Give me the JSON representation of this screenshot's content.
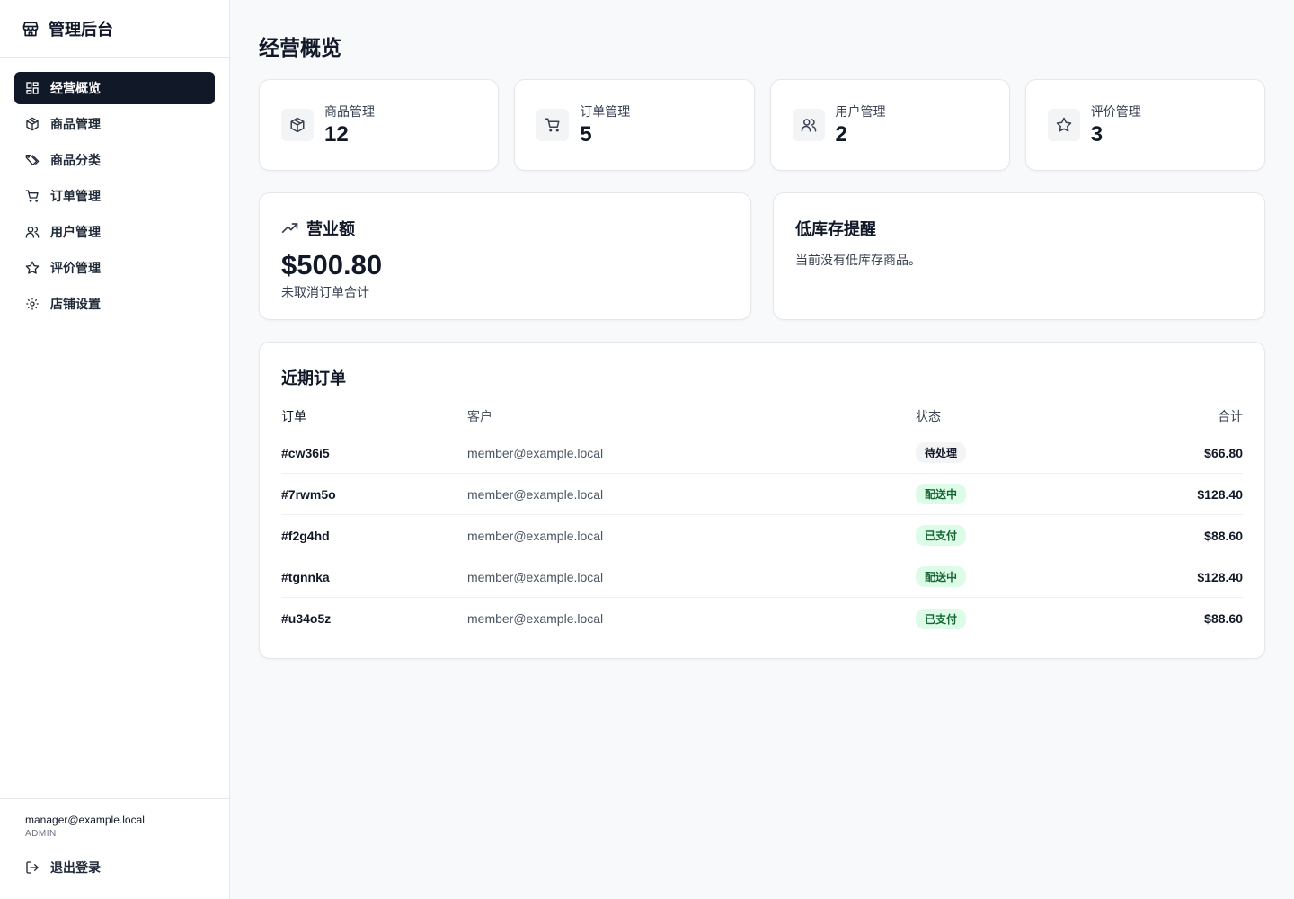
{
  "app": {
    "title": "管理后台"
  },
  "sidebar": {
    "items": [
      {
        "label": "经营概览",
        "icon": "dashboard-icon",
        "active": true
      },
      {
        "label": "商品管理",
        "icon": "package-icon"
      },
      {
        "label": "商品分类",
        "icon": "tags-icon"
      },
      {
        "label": "订单管理",
        "icon": "cart-icon"
      },
      {
        "label": "用户管理",
        "icon": "users-icon"
      },
      {
        "label": "评价管理",
        "icon": "star-icon"
      },
      {
        "label": "店铺设置",
        "icon": "gear-icon"
      }
    ],
    "user": {
      "email": "manager@example.local",
      "role": "ADMIN"
    },
    "logout_label": "退出登录"
  },
  "page": {
    "title": "经营概览"
  },
  "stats": [
    {
      "label": "商品管理",
      "value": "12",
      "icon": "package-icon"
    },
    {
      "label": "订单管理",
      "value": "5",
      "icon": "cart-icon"
    },
    {
      "label": "用户管理",
      "value": "2",
      "icon": "users-icon"
    },
    {
      "label": "评价管理",
      "value": "3",
      "icon": "star-icon"
    }
  ],
  "revenue": {
    "title": "营业额",
    "value": "$500.80",
    "note": "未取消订单合计",
    "icon": "trending-up-icon"
  },
  "low_stock": {
    "title": "低库存提醒",
    "text": "当前没有低库存商品。"
  },
  "recent_orders": {
    "title": "近期订单",
    "columns": [
      "订单",
      "客户",
      "状态",
      "合计"
    ],
    "rows": [
      {
        "id": "#cw36i5",
        "customer": "member@example.local",
        "status": "待处理",
        "total": "$66.80"
      },
      {
        "id": "#7rwm5o",
        "customer": "member@example.local",
        "status": "配送中",
        "total": "$128.40"
      },
      {
        "id": "#f2g4hd",
        "customer": "member@example.local",
        "status": "已支付",
        "total": "$88.60"
      },
      {
        "id": "#tgnnka",
        "customer": "member@example.local",
        "status": "配送中",
        "total": "$128.40"
      },
      {
        "id": "#u34o5z",
        "customer": "member@example.local",
        "status": "已支付",
        "total": "$88.60"
      }
    ]
  },
  "colors": {
    "active_nav_bg": "#111827",
    "badge_green_bg": "#dcfce7",
    "badge_green_text": "#166534",
    "badge_gray_bg": "#f3f4f6"
  }
}
